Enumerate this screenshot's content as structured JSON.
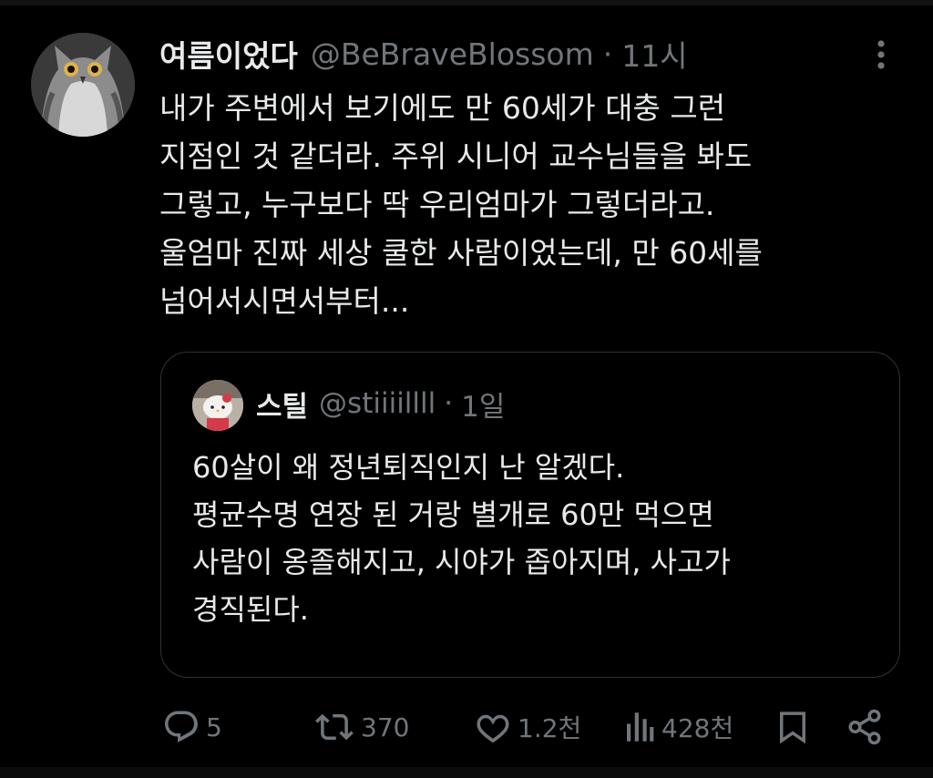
{
  "tweet": {
    "display_name": "여름이었다",
    "handle": "@BeBraveBlossom",
    "separator": "·",
    "time": "11시",
    "text_lines": [
      "내가 주변에서 보기에도 만 60세가 대충 그런",
      "지점인 것 같더라. 주위 시니어 교수님들을 봐도",
      "그렇고, 누구보다 딱 우리엄마가 그렇더라고.",
      "울엄마 진짜 세상 쿨한 사람이었는데, 만 60세를",
      "넘어서시면서부터..."
    ]
  },
  "quote": {
    "display_name": "스틸",
    "handle": "@stiiiillll",
    "separator": "·",
    "time": "1일",
    "text_lines": [
      "60살이 왜 정년퇴직인지 난 알겠다.",
      "평균수명 연장 된 거랑 별개로 60만 먹으면",
      "사람이 옹졸해지고, 시야가 좁아지며, 사고가",
      "경직된다."
    ]
  },
  "actions": {
    "replies": "5",
    "reposts": "370",
    "likes": "1.2천",
    "views": "428천"
  },
  "icons": {
    "more": "more-vertical-icon",
    "reply": "reply-icon",
    "repost": "repost-icon",
    "like": "heart-icon",
    "views": "views-chart-icon",
    "bookmark": "bookmark-icon",
    "share": "share-icon"
  },
  "colors": {
    "background": "#000000",
    "text_primary": "#e7e9ea",
    "text_secondary": "#71767b",
    "border": "#2f3336"
  }
}
